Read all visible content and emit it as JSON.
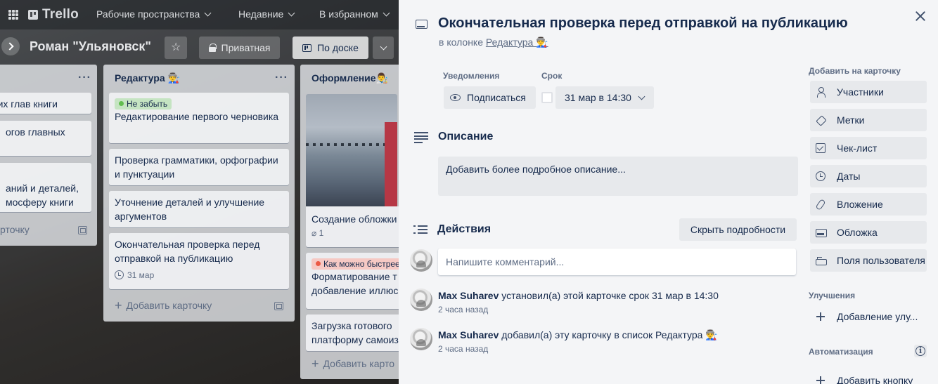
{
  "topnav": {
    "logo": "Trello",
    "workspaces": "Рабочие пространства",
    "recent": "Недавние",
    "starred": "В избранном"
  },
  "board": {
    "title": "Роман \"Ульяновск\"",
    "visibility": "Приватная",
    "view": "По доске",
    "lists": [
      {
        "title": "",
        "cards": [
          "их глав книги",
          "огов главных",
          "аний и деталей,\nмосферу книги"
        ],
        "add_label": "рточку"
      },
      {
        "title": "Редактура 👨‍🏭",
        "cards": [
          {
            "label": "Не забыть",
            "text": "Редактирование первого черновика"
          },
          {
            "text": "Проверка грамматики, орфографии и пунктуации"
          },
          {
            "text": "Уточнение деталей и улучшение аргументов"
          },
          {
            "text": "Окончательная проверка перед отправкой на публикацию",
            "due": "31 мар"
          }
        ],
        "add_label": "Добавить карточку"
      },
      {
        "title": "Оформление👨‍🎨",
        "cards": [
          {
            "text": "Создание обложки",
            "attachments": "1"
          },
          {
            "label": "Как можно быстрее",
            "text": "Форматирование т\nдобавление иллюс"
          },
          {
            "text": "Загрузка готового\nплатформу самоиз"
          }
        ],
        "add_label": "Добавить карто"
      }
    ]
  },
  "modal": {
    "title": "Окончательная проверка перед отправкой на публикацию",
    "in_list_prefix": "в колонке",
    "in_list_link": "Редактура 👨‍🏭",
    "notifications_label": "Уведомления",
    "subscribe": "Подписаться",
    "due_label": "Срок",
    "due_value": "31 мар в 14:30",
    "description_title": "Описание",
    "description_placeholder": "Добавить более подробное описание...",
    "activity_title": "Действия",
    "hide_details": "Скрыть подробности",
    "comment_placeholder": "Напишите комментарий...",
    "activity": [
      {
        "user": "Max Suharev",
        "text": "установил(а) этой карточке срок 31 мар в 14:30",
        "time": "2 часа назад"
      },
      {
        "user": "Max Suharev",
        "text": "добавил(а) эту карточку в список Редактура 👨‍🏭",
        "time": "2 часа назад"
      }
    ]
  },
  "sidebar": {
    "add_to_card": "Добавить на карточку",
    "members": "Участники",
    "labels": "Метки",
    "checklist": "Чек-лист",
    "dates": "Даты",
    "attachment": "Вложение",
    "cover": "Обложка",
    "custom_fields": "Поля пользователя",
    "powerups": "Улучшения",
    "add_powerup": "Добавление улу...",
    "automation": "Автоматизация",
    "add_button": "Добавить кнопку"
  }
}
